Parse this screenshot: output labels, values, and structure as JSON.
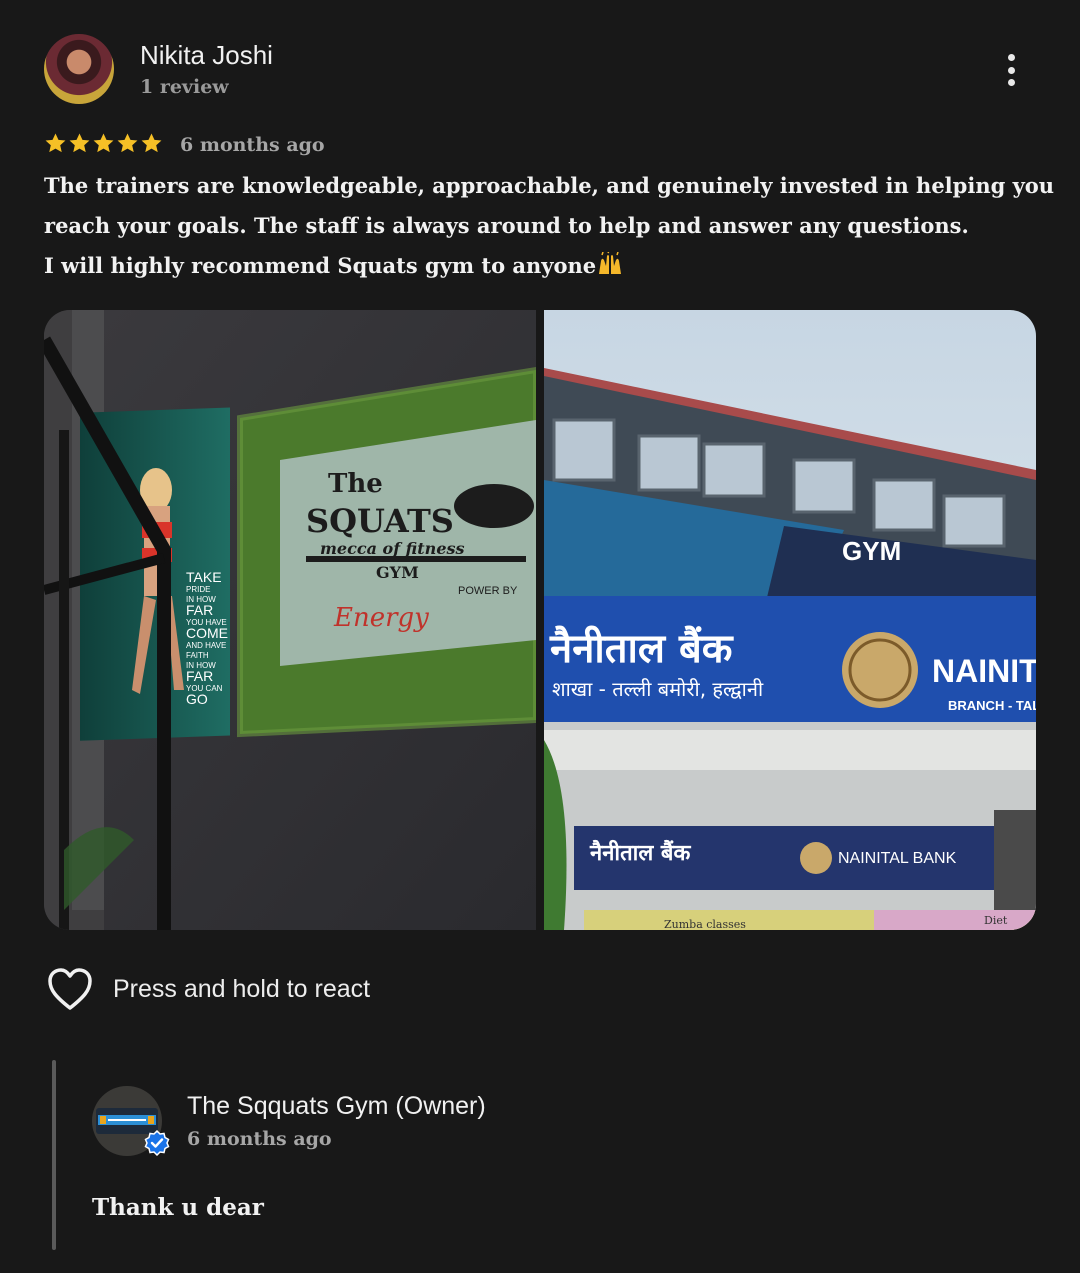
{
  "review": {
    "author_name": "Nikita Joshi",
    "author_meta": "1 review",
    "rating": 5,
    "rating_max": 5,
    "star_color": "#f6c026",
    "time_ago": "6 months ago",
    "lines": [
      "The trainers are knowledgeable, approachable, and genuinely invested in helping you",
      "reach your goals. The staff is always around to help and answer any questions.",
      "I will highly recommend Squats gym to anyone"
    ],
    "emoji": "raising-hands-icon"
  },
  "photos": {
    "left": {
      "sign_line1": "The",
      "sign_line2": "SQUATS",
      "sign_line3": "mecca of fitness",
      "sign_line4": "GYM",
      "sign_power": "POWER BY",
      "sign_brand": "Energy",
      "poster_text": [
        "TAKE",
        "PRIDE",
        "IN HOW",
        "FAR",
        "YOU HAVE",
        "COME",
        "AND HAVE",
        "FAITH",
        "IN HOW",
        "FAR",
        "YOU CAN",
        "GO"
      ]
    },
    "right": {
      "gym_sign": "GYM",
      "bank_hindi": "नैनीताल बैंक",
      "bank_branch_hindi": "शाखा - तल्ली बमोरी, हल्द्वानी",
      "bank_en": "NAINIT",
      "bank_branch_en": "BRANCH - TAL",
      "lower_hindi": "नैनीताल बैंक",
      "lower_en": "NAINITAL BANK",
      "strip_text": "Zumba classes",
      "strip_text2": "Diet"
    }
  },
  "react": {
    "label": "Press and hold to react",
    "icon": "heart-outline-icon"
  },
  "owner_reply": {
    "name": "The Sqquats Gym (Owner)",
    "time_ago": "6 months ago",
    "text": "Thank u dear",
    "verified_color": "#1a73e8"
  }
}
